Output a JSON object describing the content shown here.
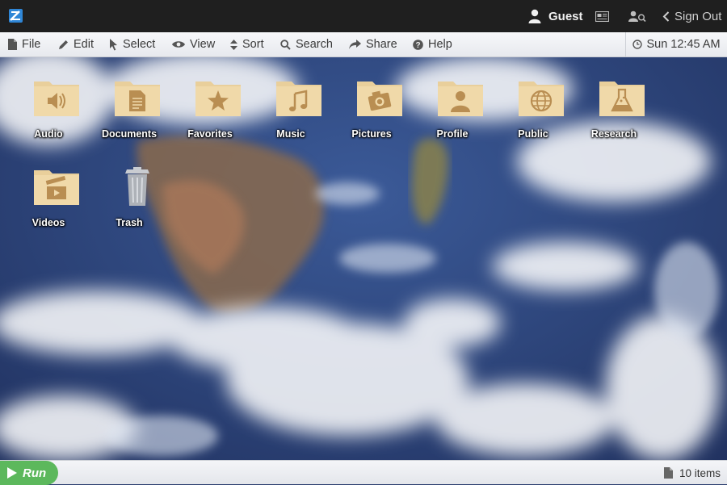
{
  "topbar": {
    "user_name": "Guest",
    "signout_label": "Sign Out",
    "icons": [
      "logo-icon",
      "user-icon",
      "workspace-icon",
      "user-search-icon",
      "chevron-left-icon"
    ]
  },
  "menu": {
    "items": [
      {
        "label": "File",
        "icon": "file-icon"
      },
      {
        "label": "Edit",
        "icon": "pencil-icon"
      },
      {
        "label": "Select",
        "icon": "cursor-icon"
      },
      {
        "label": "View",
        "icon": "eye-icon"
      },
      {
        "label": "Sort",
        "icon": "sort-icon"
      },
      {
        "label": "Search",
        "icon": "search-icon"
      },
      {
        "label": "Share",
        "icon": "share-icon"
      },
      {
        "label": "Help",
        "icon": "help-icon"
      }
    ],
    "clock": "Sun 12:45 AM"
  },
  "desktop": {
    "icons": [
      {
        "label": "Audio",
        "icon": "speaker-folder-icon"
      },
      {
        "label": "Documents",
        "icon": "document-folder-icon"
      },
      {
        "label": "Favorites",
        "icon": "star-folder-icon"
      },
      {
        "label": "Music",
        "icon": "music-note-folder-icon"
      },
      {
        "label": "Pictures",
        "icon": "camera-folder-icon"
      },
      {
        "label": "Profile",
        "icon": "person-folder-icon"
      },
      {
        "label": "Public",
        "icon": "globe-folder-icon"
      },
      {
        "label": "Research",
        "icon": "flask-folder-icon"
      },
      {
        "label": "Videos",
        "icon": "clapperboard-folder-icon"
      },
      {
        "label": "Trash",
        "icon": "trash-can-icon"
      }
    ]
  },
  "bottombar": {
    "run_label": "Run",
    "item_count": "10 items"
  },
  "colors": {
    "topbar_bg": "#1f1f1f",
    "folder": "#e9cf9b",
    "folder_glyph": "#b98e52",
    "run_green": "#5cb85c",
    "logo_blue": "#2f86d6"
  }
}
